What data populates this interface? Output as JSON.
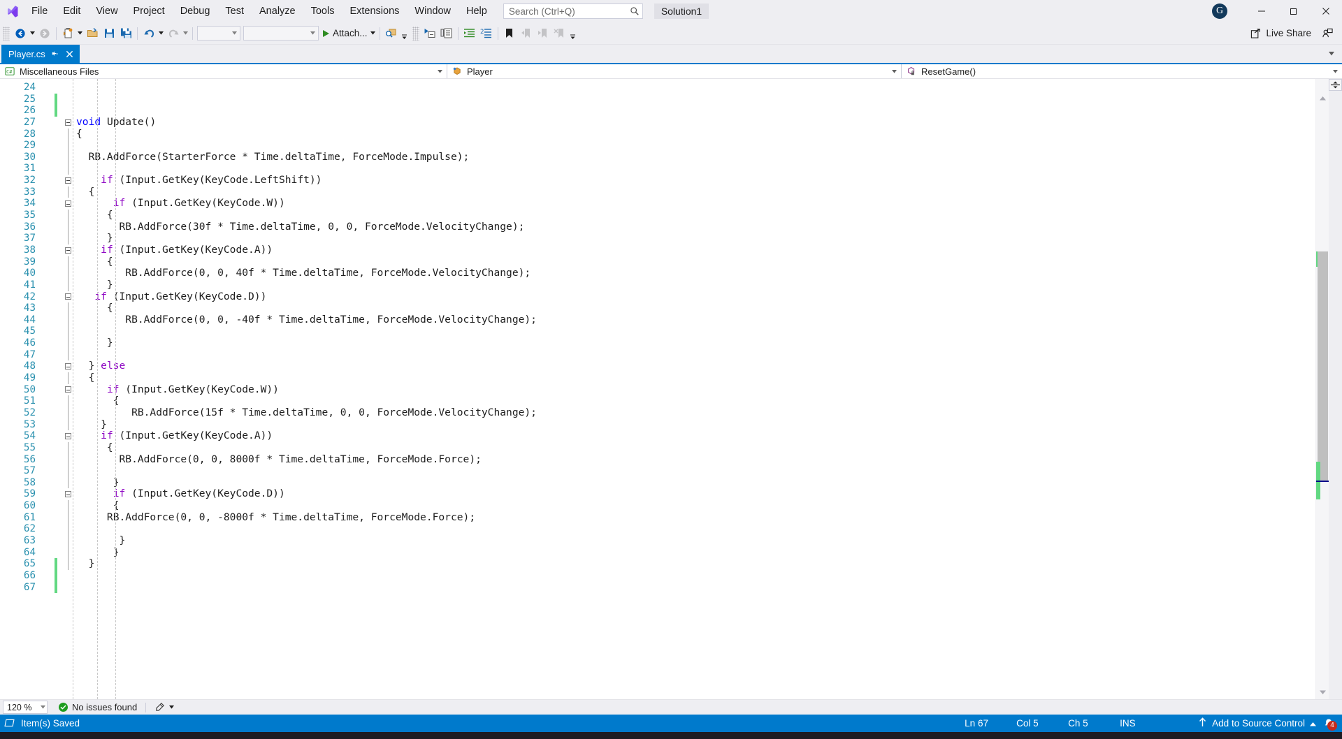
{
  "window": {
    "logo_icon": "visual-studio-logo",
    "solution_chip": "Solution1",
    "account_initial": "G",
    "minimize_icon": "minimize-icon",
    "maximize_icon": "maximize-icon",
    "close_icon": "close-icon"
  },
  "menu": {
    "items": [
      {
        "label": "File"
      },
      {
        "label": "Edit"
      },
      {
        "label": "View"
      },
      {
        "label": "Project"
      },
      {
        "label": "Debug"
      },
      {
        "label": "Test"
      },
      {
        "label": "Analyze"
      },
      {
        "label": "Tools"
      },
      {
        "label": "Extensions"
      },
      {
        "label": "Window"
      },
      {
        "label": "Help"
      }
    ]
  },
  "search": {
    "placeholder": "Search (Ctrl+Q)",
    "value": "",
    "icon": "search-icon"
  },
  "toolbar": {
    "back_icon": "navigate-back-icon",
    "forward_icon": "navigate-forward-icon",
    "new_file_icon": "new-file-icon",
    "open_file_icon": "open-file-icon",
    "save_icon": "save-icon",
    "save_all_icon": "save-all-icon",
    "undo_icon": "undo-icon",
    "redo_icon": "redo-icon",
    "config_value": "",
    "platform_value": "",
    "attach_label": "Attach...",
    "find_icon": "find-in-files-icon",
    "step_into_icon": "step-into-icon",
    "step_over_icon": "step-over-icon",
    "indent_icon": "increase-indent-icon",
    "comment_icon": "comment-selection-icon",
    "bookmark_icon": "bookmark-icon",
    "prev_bookmark_icon": "previous-bookmark-icon",
    "next_bookmark_icon": "next-bookmark-icon",
    "clear_bookmark_icon": "clear-bookmarks-icon",
    "overflow_icon": "toolbar-overflow-icon",
    "live_share_label": "Live Share",
    "live_share_icon": "live-share-icon",
    "feedback_icon": "send-feedback-icon"
  },
  "tabs": {
    "active": {
      "label": "Player.cs",
      "pin_icon": "pin-icon",
      "close_icon": "close-tab-icon"
    },
    "overflow_icon": "tab-overflow-icon"
  },
  "navbar": {
    "project": {
      "label": "Miscellaneous Files",
      "icon": "csharp-file-icon"
    },
    "type": {
      "label": "Player",
      "icon": "class-icon"
    },
    "member": {
      "label": "ResetGame()",
      "icon": "method-private-icon"
    },
    "dropdown_icon": "chevron-down-icon"
  },
  "editor": {
    "first_line": 24,
    "lines": [
      {
        "n": 24,
        "change": false,
        "fold": "none",
        "text": ""
      },
      {
        "n": 25,
        "change": true,
        "fold": "none",
        "text": ""
      },
      {
        "n": 26,
        "change": true,
        "fold": "none",
        "text": ""
      },
      {
        "n": 27,
        "change": false,
        "fold": "box",
        "text": "void Update()",
        "indent": 4
      },
      {
        "n": 28,
        "change": false,
        "fold": "line",
        "text": "{",
        "indent": 4
      },
      {
        "n": 29,
        "change": false,
        "fold": "line",
        "text": "",
        "indent": 4
      },
      {
        "n": 30,
        "change": false,
        "fold": "line",
        "text": "  RB.AddForce(StarterForce * Time.deltaTime, ForceMode.Impulse);",
        "indent": 4
      },
      {
        "n": 31,
        "change": false,
        "fold": "line",
        "text": "",
        "indent": 4
      },
      {
        "n": 32,
        "change": false,
        "fold": "box",
        "text": "    if (Input.GetKey(KeyCode.LeftShift))",
        "indent": 4
      },
      {
        "n": 33,
        "change": false,
        "fold": "line",
        "text": "  {",
        "indent": 4
      },
      {
        "n": 34,
        "change": false,
        "fold": "box",
        "text": "      if (Input.GetKey(KeyCode.W))",
        "indent": 4
      },
      {
        "n": 35,
        "change": false,
        "fold": "line",
        "text": "     {",
        "indent": 4
      },
      {
        "n": 36,
        "change": false,
        "fold": "line",
        "text": "       RB.AddForce(30f * Time.deltaTime, 0, 0, ForceMode.VelocityChange);",
        "indent": 4
      },
      {
        "n": 37,
        "change": false,
        "fold": "line",
        "text": "     }",
        "indent": 4
      },
      {
        "n": 38,
        "change": false,
        "fold": "box",
        "text": "    if (Input.GetKey(KeyCode.A))",
        "indent": 4
      },
      {
        "n": 39,
        "change": false,
        "fold": "line",
        "text": "     {",
        "indent": 4
      },
      {
        "n": 40,
        "change": false,
        "fold": "line",
        "text": "        RB.AddForce(0, 0, 40f * Time.deltaTime, ForceMode.VelocityChange);",
        "indent": 4
      },
      {
        "n": 41,
        "change": false,
        "fold": "line",
        "text": "     }",
        "indent": 4
      },
      {
        "n": 42,
        "change": false,
        "fold": "box",
        "text": "   if (Input.GetKey(KeyCode.D))",
        "indent": 4
      },
      {
        "n": 43,
        "change": false,
        "fold": "line",
        "text": "     {",
        "indent": 4
      },
      {
        "n": 44,
        "change": false,
        "fold": "line",
        "text": "        RB.AddForce(0, 0, -40f * Time.deltaTime, ForceMode.VelocityChange);",
        "indent": 4
      },
      {
        "n": 45,
        "change": false,
        "fold": "line",
        "text": "",
        "indent": 4
      },
      {
        "n": 46,
        "change": false,
        "fold": "line",
        "text": "     }",
        "indent": 4
      },
      {
        "n": 47,
        "change": false,
        "fold": "line",
        "text": "",
        "indent": 4
      },
      {
        "n": 48,
        "change": false,
        "fold": "box",
        "text": "  } else",
        "indent": 4
      },
      {
        "n": 49,
        "change": false,
        "fold": "line",
        "text": "  {",
        "indent": 4
      },
      {
        "n": 50,
        "change": false,
        "fold": "box",
        "text": "     if (Input.GetKey(KeyCode.W))",
        "indent": 4
      },
      {
        "n": 51,
        "change": false,
        "fold": "line",
        "text": "      {",
        "indent": 4
      },
      {
        "n": 52,
        "change": false,
        "fold": "line",
        "text": "         RB.AddForce(15f * Time.deltaTime, 0, 0, ForceMode.VelocityChange);",
        "indent": 4
      },
      {
        "n": 53,
        "change": false,
        "fold": "line",
        "text": "    }",
        "indent": 4
      },
      {
        "n": 54,
        "change": false,
        "fold": "box",
        "text": "    if (Input.GetKey(KeyCode.A))",
        "indent": 4
      },
      {
        "n": 55,
        "change": false,
        "fold": "line",
        "text": "     {",
        "indent": 4
      },
      {
        "n": 56,
        "change": false,
        "fold": "line",
        "text": "       RB.AddForce(0, 0, 8000f * Time.deltaTime, ForceMode.Force);",
        "indent": 4
      },
      {
        "n": 57,
        "change": false,
        "fold": "line",
        "text": "",
        "indent": 4
      },
      {
        "n": 58,
        "change": false,
        "fold": "line",
        "text": "      }",
        "indent": 4
      },
      {
        "n": 59,
        "change": false,
        "fold": "box",
        "text": "      if (Input.GetKey(KeyCode.D))",
        "indent": 4
      },
      {
        "n": 60,
        "change": false,
        "fold": "line",
        "text": "      {",
        "indent": 4
      },
      {
        "n": 61,
        "change": false,
        "fold": "line",
        "text": "     RB.AddForce(0, 0, -8000f * Time.deltaTime, ForceMode.Force);",
        "indent": 4
      },
      {
        "n": 62,
        "change": false,
        "fold": "line",
        "text": "",
        "indent": 4
      },
      {
        "n": 63,
        "change": false,
        "fold": "line",
        "text": "       }",
        "indent": 4
      },
      {
        "n": 64,
        "change": false,
        "fold": "line",
        "text": "      }",
        "indent": 4
      },
      {
        "n": 65,
        "change": true,
        "fold": "line",
        "text": "  }",
        "indent": 4
      },
      {
        "n": 66,
        "change": true,
        "fold": "none",
        "text": "",
        "indent": 4
      },
      {
        "n": 67,
        "change": true,
        "fold": "none",
        "text": "",
        "indent": 4
      }
    ],
    "caret": {
      "line": 67,
      "col": 5
    }
  },
  "editor_status": {
    "zoom": "120 %",
    "issues": "No issues found",
    "issues_icon": "check-circle-icon",
    "brush_icon": "code-cleanup-icon",
    "dropdown_icon": "chevron-down-icon"
  },
  "statusbar": {
    "message": "Item(s) Saved",
    "message_icon": "saved-icon",
    "ln": "Ln 67",
    "col": "Col 5",
    "ch": "Ch 5",
    "ins": "INS",
    "source_control": "Add to Source Control",
    "source_control_icon": "upload-arrow-icon",
    "source_control_caret": "chevron-up-icon",
    "bell_icon": "notifications-icon",
    "bell_count": "4"
  },
  "colors": {
    "accent": "#007ACC",
    "chrome": "#EEEEF2",
    "editor_bg": "#FFFFFF",
    "line_number": "#2B91AF",
    "keyword": "#0000FF",
    "control_keyword": "#8F08C4",
    "change_bar": "#62D882",
    "error_badge": "#C42B1C"
  }
}
